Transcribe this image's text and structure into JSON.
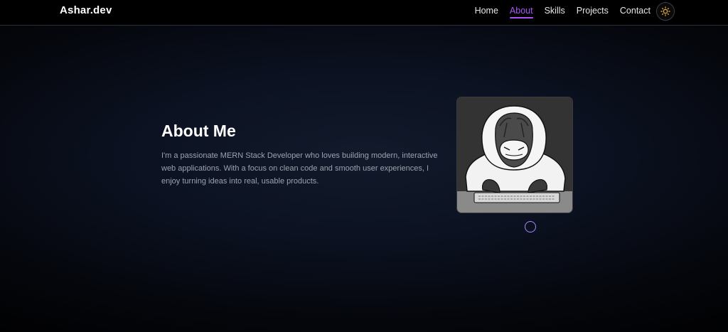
{
  "nav": {
    "brand": "Ashar.dev",
    "links": [
      "Home",
      "About",
      "Skills",
      "Projects",
      "Contact"
    ],
    "active_link": "About",
    "theme_toggle_icon": "sun-icon"
  },
  "about": {
    "title": "About Me",
    "description": "I'm a passionate MERN Stack Developer who loves building modern, interactive web applications. With a focus on clean code and smooth user experiences, I enjoy turning ideas into real, usable products."
  },
  "colors": {
    "accent": "#a855f7",
    "sun": "#f5b942",
    "text_muted": "#9ca3af"
  }
}
